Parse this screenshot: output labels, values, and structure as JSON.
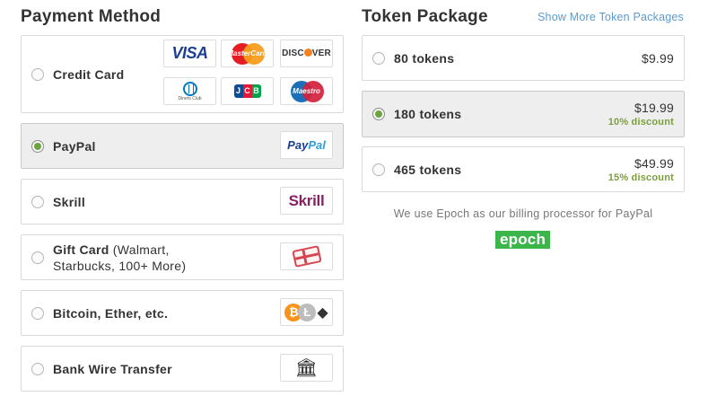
{
  "payment_method": {
    "title": "Payment Method",
    "options": [
      {
        "label": "Credit Card",
        "selected": false,
        "logos": [
          "VISA",
          "MasterCard",
          "DISCOVER",
          "Diners Club",
          "JCB",
          "Maestro"
        ]
      },
      {
        "label": "PayPal",
        "selected": true,
        "logo_text": [
          "Pay",
          "Pal"
        ]
      },
      {
        "label": "Skrill",
        "selected": false,
        "logo_text": "Skrill"
      },
      {
        "label": "Gift Card",
        "sub_label": "(Walmart, Starbucks, 100+ More)",
        "selected": false,
        "icon": "gift-card-icon"
      },
      {
        "label": "Bitcoin, Ether, etc.",
        "selected": false,
        "icon": "crypto-coins-icon",
        "coin_glyphs": [
          "₿",
          "Ł",
          "◆"
        ]
      },
      {
        "label": "Bank Wire Transfer",
        "selected": false,
        "icon": "bank-icon",
        "icon_glyph": "🏛"
      }
    ],
    "discover_parts": [
      "DISC",
      "VER"
    ]
  },
  "token_package": {
    "title": "Token Package",
    "more_link": "Show More Token Packages",
    "packages": [
      {
        "label": "80 tokens",
        "price": "$9.99",
        "discount": "",
        "selected": false
      },
      {
        "label": "180 tokens",
        "price": "$19.99",
        "discount": "10% discount",
        "selected": true
      },
      {
        "label": "465 tokens",
        "price": "$49.99",
        "discount": "15% discount",
        "selected": false
      }
    ],
    "billing_note": "We use Epoch as our billing processor for PayPal",
    "processor_logo": "epoch"
  },
  "colors": {
    "radio_selected": "#6ca33c",
    "discount_text": "#7c9f3c",
    "link": "#5b9bd0",
    "epoch_green": "#3cb64a"
  }
}
